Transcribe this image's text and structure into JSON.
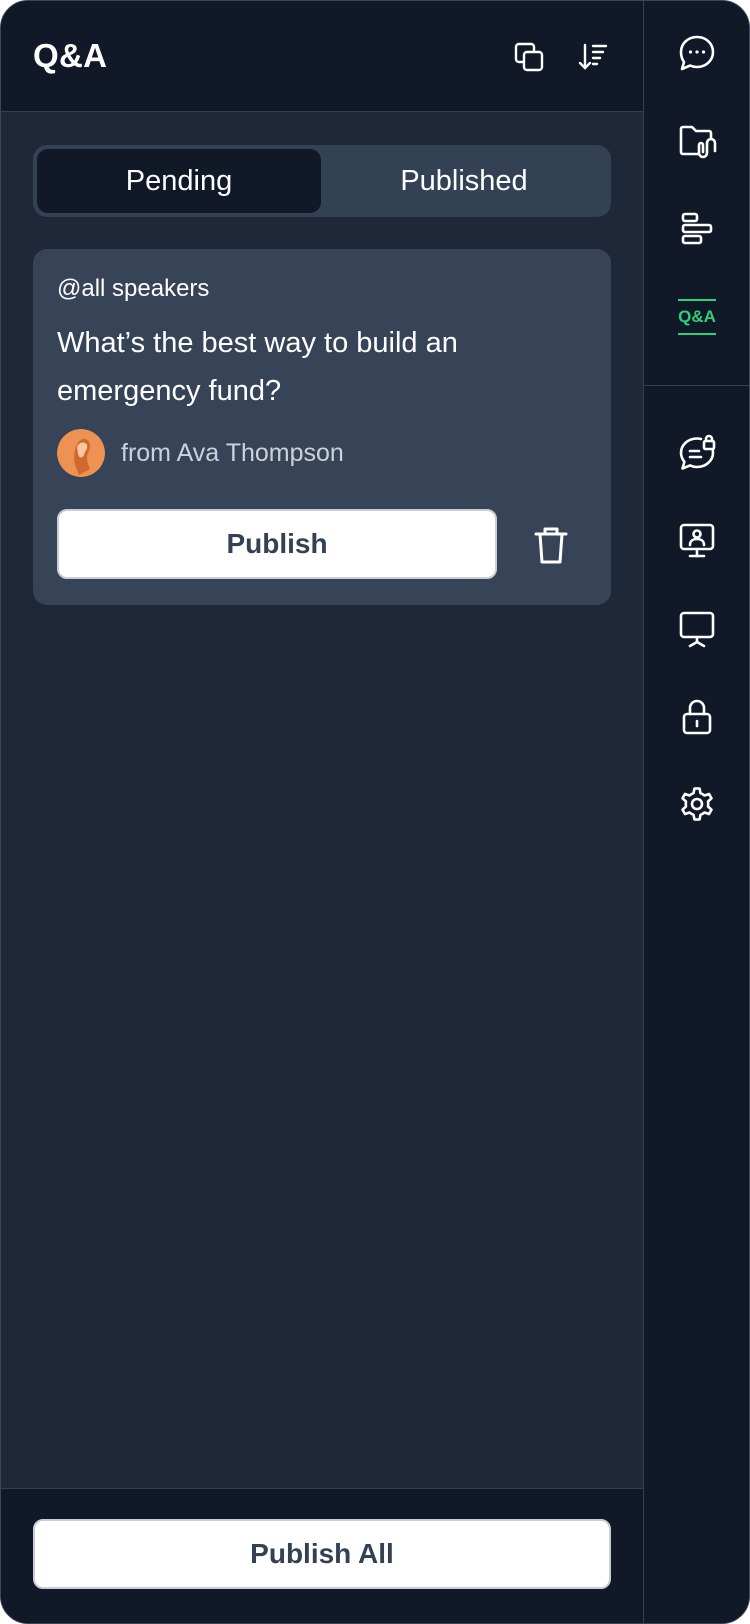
{
  "header": {
    "title": "Q&A",
    "copy_icon": "copy-icon",
    "sort_icon": "sort-icon"
  },
  "tabs": [
    {
      "label": "Pending",
      "active": true
    },
    {
      "label": "Published",
      "active": false
    }
  ],
  "questions": [
    {
      "audience": "@all speakers",
      "text": "What’s the best way to build an emergency fund?",
      "author": "from Ava Thompson",
      "publish_label": "Publish",
      "delete_icon": "trash-icon"
    }
  ],
  "footer": {
    "publish_all_label": "Publish All"
  },
  "rail": {
    "items": [
      {
        "name": "chat",
        "icon": "chat-bubble-icon"
      },
      {
        "name": "files",
        "icon": "folder-attachment-icon"
      },
      {
        "name": "agenda",
        "icon": "align-left-bars-icon"
      },
      {
        "name": "qa",
        "label": "Q&A",
        "active": true
      },
      {
        "name": "private-chat",
        "icon": "chat-lock-icon"
      },
      {
        "name": "speaker-screen",
        "icon": "monitor-user-icon"
      },
      {
        "name": "presentation",
        "icon": "presentation-board-icon"
      },
      {
        "name": "lock",
        "icon": "lock-icon"
      },
      {
        "name": "settings",
        "icon": "gear-icon"
      }
    ]
  },
  "colors": {
    "background": "#1f2838",
    "header": "#111827",
    "card": "#374457",
    "accent": "#2bd27a",
    "button_text": "#334155"
  }
}
